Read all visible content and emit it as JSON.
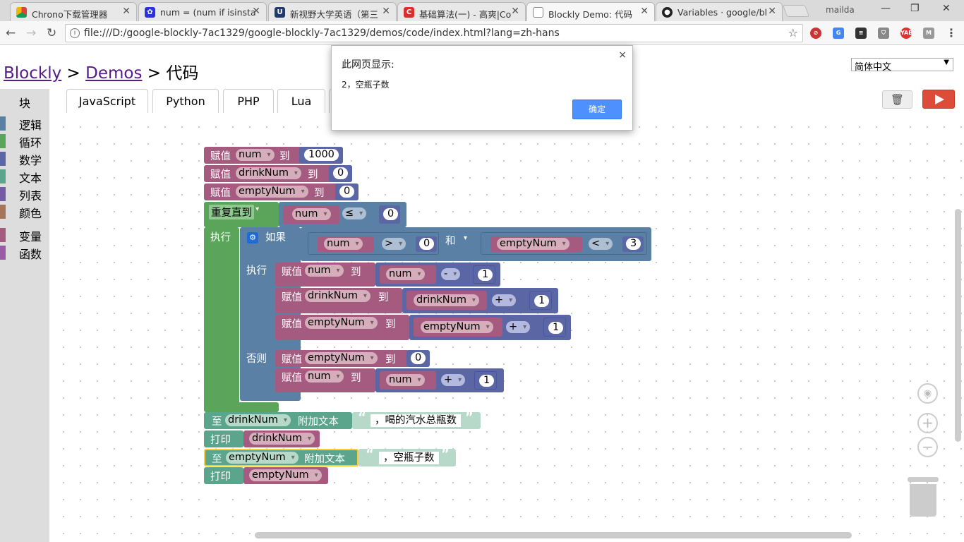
{
  "browser": {
    "tabs": [
      {
        "label": "Chrono下载管理器",
        "icon": "chrono-icon"
      },
      {
        "label": "num = (num if isinsta",
        "icon": "baidu-paw-icon"
      },
      {
        "label": "新视野大学英语（第三",
        "icon": "unipus-u-icon"
      },
      {
        "label": "基础算法(一) - 高爽|Co",
        "icon": "cnblogs-c-icon"
      },
      {
        "label": "Blockly Demo: 代码",
        "icon": "page-icon"
      },
      {
        "label": "Variables · google/bl",
        "icon": "github-icon"
      }
    ],
    "user": "mailda",
    "url": "file:///D:/google-blockly-7ac1329/google-blockly-7ac1329/demos/code/index.html?lang=zh-hans"
  },
  "header": {
    "crumb1": "Blockly",
    "crumb2": "Demos",
    "sep1": ">",
    "sep2": ">",
    "current": "代码",
    "language": "简体中文"
  },
  "code_tabs": [
    "块",
    "JavaScript",
    "Python",
    "PHP",
    "Lua"
  ],
  "categories": [
    {
      "label": "逻辑",
      "color": "#5b80a5"
    },
    {
      "label": "循环",
      "color": "#5ba55b"
    },
    {
      "label": "数学",
      "color": "#5b67a5"
    },
    {
      "label": "文本",
      "color": "#5ba58c"
    },
    {
      "label": "列表",
      "color": "#745ba5"
    },
    {
      "label": "颜色",
      "color": "#a5745b"
    },
    {
      "label": "变量",
      "color": "#a55b80"
    },
    {
      "label": "函数",
      "color": "#995ba5"
    }
  ],
  "blocks": {
    "set": "赋值",
    "to": "到",
    "repeat_until": "重复直到",
    "do": "执行",
    "if": "如果",
    "else": "否则",
    "and": "和",
    "append_to": "至",
    "append_text": "附加文本",
    "print": "打印",
    "var_num": "num",
    "var_drink": "drinkNum",
    "var_empty": "emptyNum",
    "n1000": "1000",
    "n0": "0",
    "n1": "1",
    "n3": "3",
    "op_le": "≤",
    "op_gt": ">",
    "op_lt": "<",
    "op_minus": "-",
    "op_plus": "+",
    "text1": "，喝的汽水总瓶数",
    "text2": "，空瓶子数",
    "quote_open": "“",
    "quote_close": "”"
  },
  "colors": {
    "variables": "#a55b80",
    "loops": "#5ba55b",
    "logic": "#5b80a5",
    "math": "#5b67a5",
    "text": "#5ba58c",
    "run": "#dd4b39"
  },
  "dialog": {
    "title": "此网页显示:",
    "message": "2，空瓶子数",
    "ok": "确定",
    "close": "×"
  }
}
